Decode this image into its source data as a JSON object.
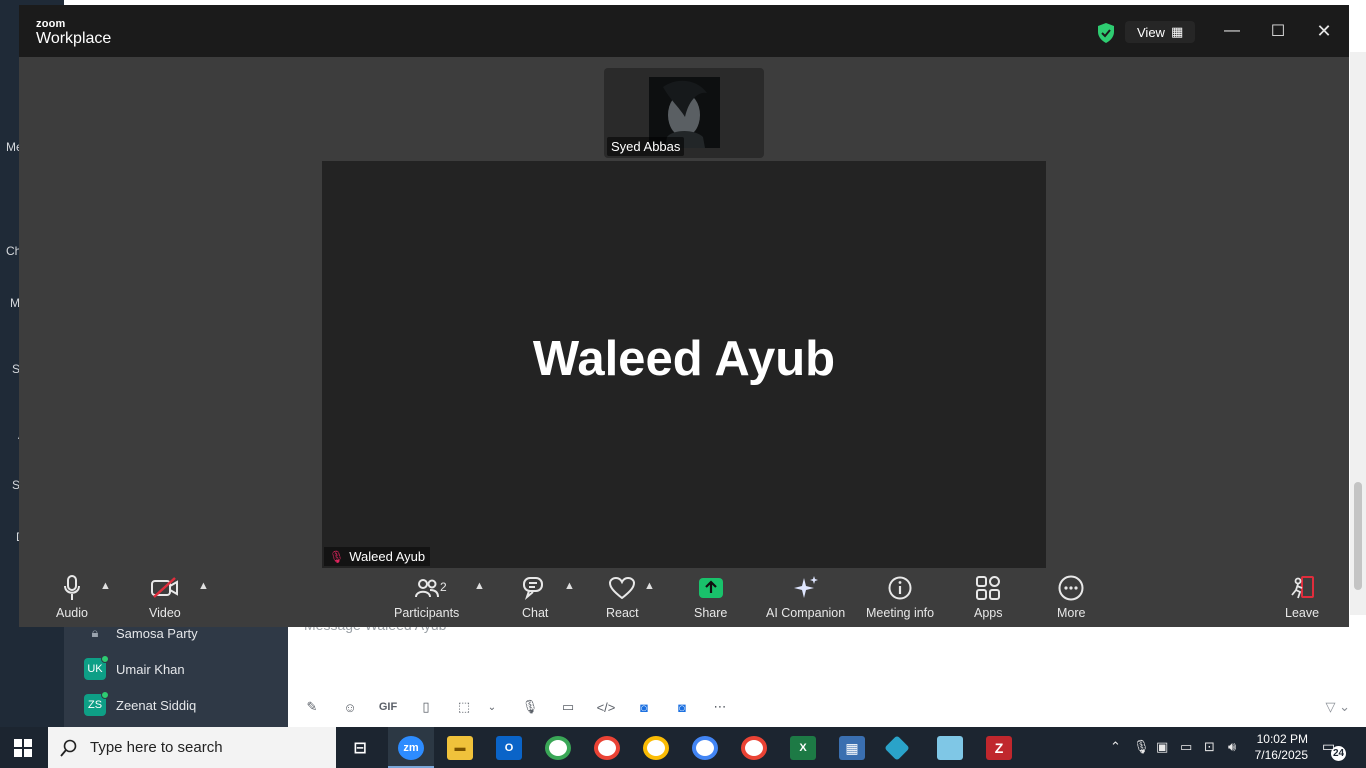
{
  "zoom": {
    "brand_top": "zoom",
    "brand_bottom": "Workplace",
    "view_label": "View",
    "thumbnail_name": "Syed Abbas",
    "main_display_name": "Waleed Ayub",
    "main_label": "Waleed Ayub",
    "controls": {
      "audio": "Audio",
      "video": "Video",
      "participants": "Participants",
      "participants_count": "2",
      "chat": "Chat",
      "react": "React",
      "share": "Share",
      "ai_companion": "AI Companion",
      "meeting_info": "Meeting info",
      "apps": "Apps",
      "more": "More",
      "leave": "Leave"
    },
    "colors": {
      "share_green": "#19c26b",
      "leave_red": "#e02d3c",
      "secure_green": "#2ecc71"
    }
  },
  "background_app": {
    "side_labels": [
      "Me",
      "Ch",
      "M",
      "S",
      "A",
      "S",
      "D"
    ],
    "list": [
      {
        "icon": "lock-icon",
        "label": "Samosa Party"
      },
      {
        "initials": "UK",
        "label": "Umair Khan"
      },
      {
        "initials": "ZS",
        "label": "Zeenat Siddiq"
      }
    ],
    "compose_placeholder": "Message Waleed Ayub",
    "compose_tools": [
      "format-icon",
      "emoji-icon",
      "GIF",
      "file-icon",
      "screenshot-icon",
      "chevron-down-icon",
      "mic-icon",
      "video-clip-icon",
      "code-icon",
      "app-icon",
      "app2-icon",
      "more-icon"
    ]
  },
  "taskbar": {
    "search_placeholder": "Type here to search",
    "time": "10:02 PM",
    "date": "7/16/2025",
    "notification_count": "24"
  }
}
